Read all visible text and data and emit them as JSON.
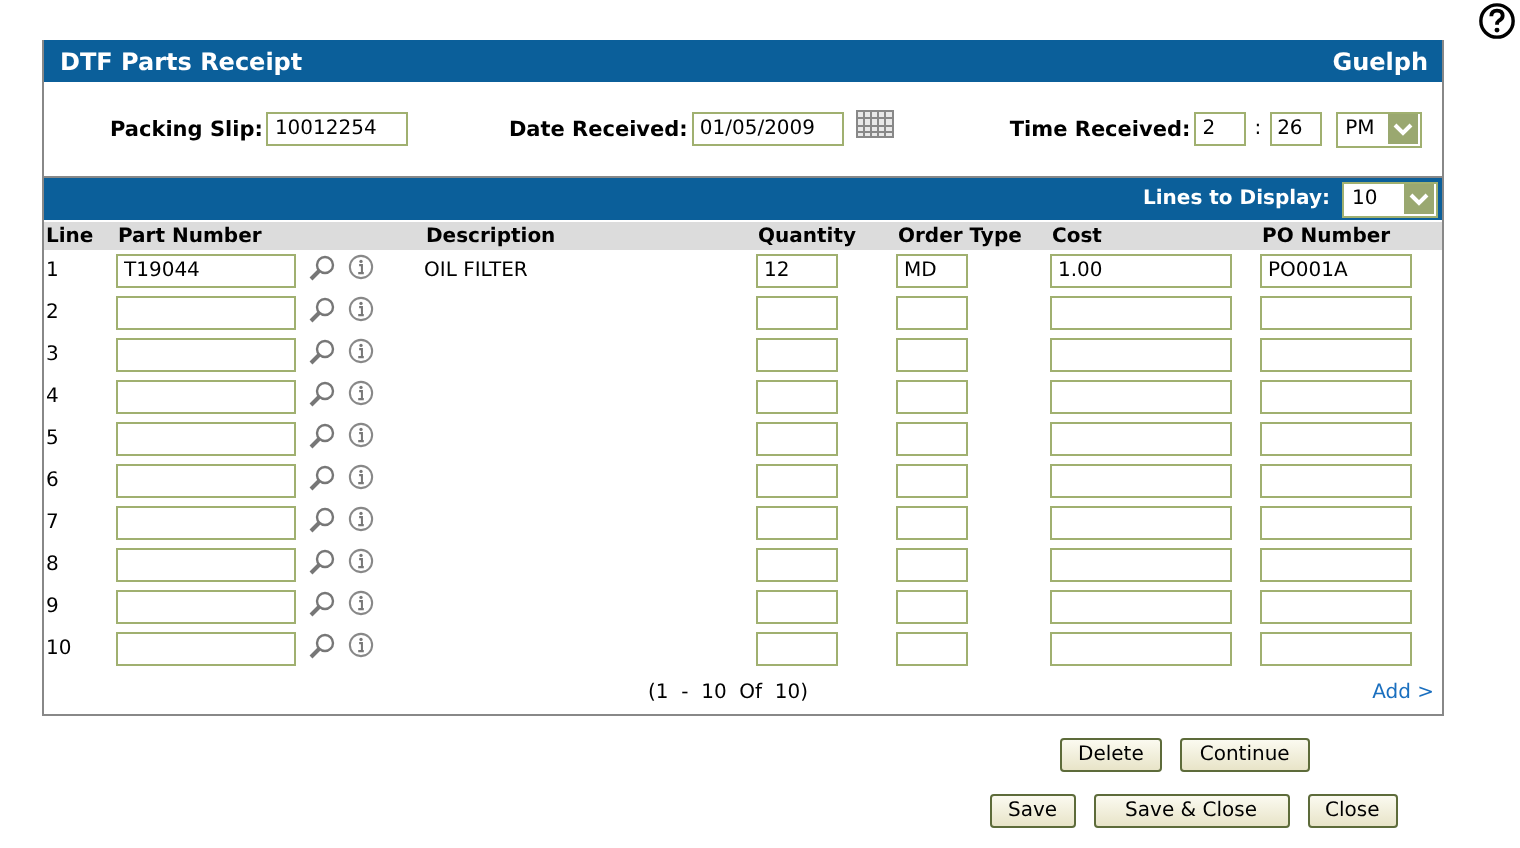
{
  "panel": {
    "title": "DTF Parts Receipt",
    "location": "Guelph"
  },
  "fields": {
    "packing_slip": {
      "label": "Packing Slip:",
      "value": "10012254"
    },
    "date_received": {
      "label": "Date Received:",
      "value": "01/05/2009"
    },
    "time_received": {
      "label": "Time Received:",
      "hour": "2",
      "separator": ":",
      "minute": "26",
      "period": "PM"
    }
  },
  "lines_to_display": {
    "label": "Lines to Display:",
    "value": "10"
  },
  "columns": [
    "Line",
    "Part Number",
    "Description",
    "Quantity",
    "Order Type",
    "Cost",
    "PO Number"
  ],
  "rows": [
    {
      "line": "1",
      "part_number": "T19044",
      "description": "OIL FILTER",
      "quantity": "12",
      "order_type": "MD",
      "cost": "1.00",
      "po_number": "PO001A"
    },
    {
      "line": "2"
    },
    {
      "line": "3"
    },
    {
      "line": "4"
    },
    {
      "line": "5"
    },
    {
      "line": "6"
    },
    {
      "line": "7"
    },
    {
      "line": "8"
    },
    {
      "line": "9"
    },
    {
      "line": "10"
    }
  ],
  "pagination": "(1  -  10  Of  10)",
  "add_link": "Add >",
  "buttons_row_1": [
    "Delete",
    "Continue"
  ],
  "buttons_row_2": [
    "Save",
    "Save & Close",
    "Close"
  ]
}
